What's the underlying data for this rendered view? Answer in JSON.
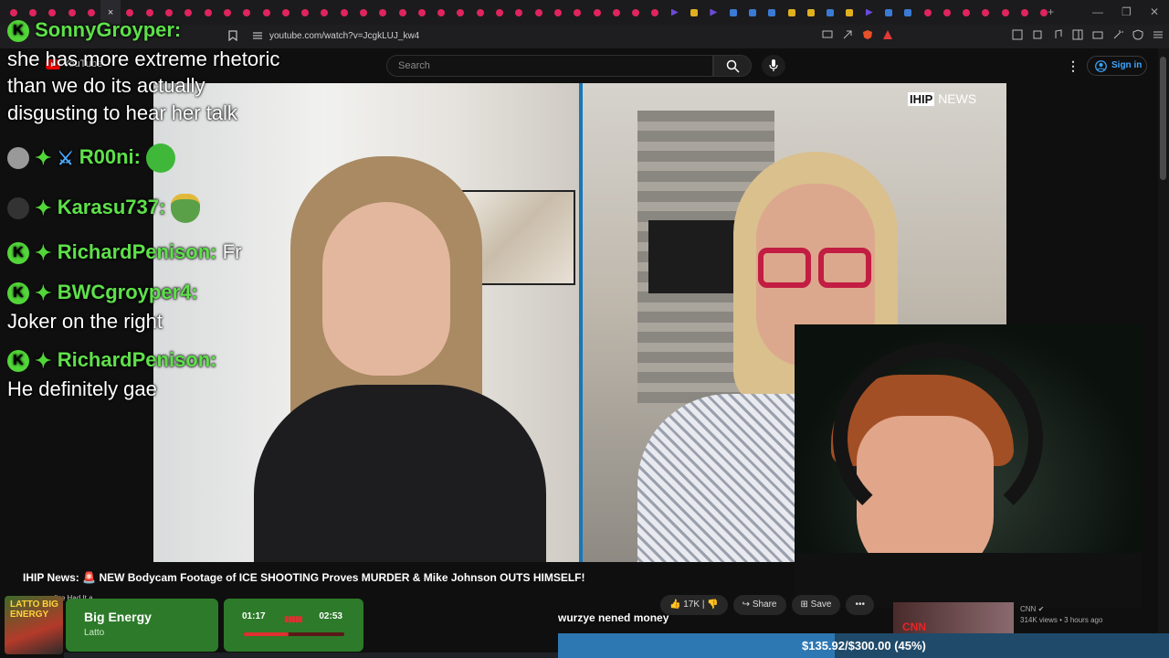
{
  "browser": {
    "tab_count_visible": 54,
    "close_tab_glyph": "×",
    "url": "youtube.com/watch?v=JcgkLUJ_kw4",
    "window_controls": [
      "—",
      "❐",
      "✕"
    ],
    "new_tab": "+"
  },
  "youtube": {
    "logo_text": "YouTube",
    "search_placeholder": "Search",
    "sign_in_label": "Sign in",
    "video_title_prefix": "IHIP News: ",
    "video_title": "NEW Bodycam Footage of ICE SHOOTING Proves MURDER & Mike Johnson OUTS HIMSELF!",
    "like_count": "17K",
    "share_label": "Share",
    "save_label": "Save",
    "more_label": "•••",
    "suggested": {
      "channel": "CNN",
      "meta": "314K views • 3 hours ago",
      "thumb_text": "CNN"
    },
    "channel_overlay": "IHIP",
    "channel_overlay_2": "NEWS"
  },
  "chat": [
    {
      "user": "SonnyGroyper:",
      "badges": [
        "k"
      ],
      "message": ""
    },
    {
      "user": "",
      "badges": [],
      "message": "she has more extreme rhetoric"
    },
    {
      "user": "",
      "badges": [],
      "message": "than we do its actually"
    },
    {
      "user": "",
      "badges": [],
      "message": "disgusting to hear her talk"
    },
    {
      "user": "R00ni:",
      "badges": [
        "avatar",
        "plus",
        "sword"
      ],
      "message": ""
    },
    {
      "user": "Karasu737:",
      "badges": [
        "avatar-dark",
        "plus"
      ],
      "message": ""
    },
    {
      "user": "RichardPenison:",
      "badges": [
        "k",
        "plus"
      ],
      "message": "Fr"
    },
    {
      "user": "BWCgroyper4:",
      "badges": [
        "k",
        "plus"
      ],
      "message": ""
    },
    {
      "user": "",
      "badges": [],
      "message": "Joker on the right"
    },
    {
      "user": "RichardPenison:",
      "badges": [
        "k",
        "plus"
      ],
      "message": ""
    },
    {
      "user": "",
      "badges": [],
      "message": "He definitely gae"
    }
  ],
  "overlay": {
    "subtitle": "wurzye nened money",
    "song_title": "Big Energy",
    "song_artist": "Latto",
    "album_text": "LATTO BIG ENERGY",
    "time_elapsed": "01:17",
    "time_total": "02:53",
    "progress_fraction": 0.445,
    "volume_glyph": "▮▮▮▮▮",
    "goal_text": "$135.92/$300.00 (45%)",
    "goal_fraction": 0.453,
    "small_text": "\"ve Had It a"
  },
  "colors": {
    "chat_username": "#5ee04a",
    "badge_green": "#52d639",
    "youtube_red": "#ff0000",
    "divider_blue": "#1778b8",
    "glasses_red": "#c21d42",
    "music_green": "#2d7a2a",
    "goal_blue": "#2d78b3"
  },
  "icons": [
    "search-icon",
    "mic-icon",
    "user-circle-icon",
    "kebab-menu-icon",
    "bookmark-icon",
    "thumbs-up-icon",
    "thumbs-down-icon",
    "share-icon",
    "save-icon",
    "verified-icon"
  ]
}
